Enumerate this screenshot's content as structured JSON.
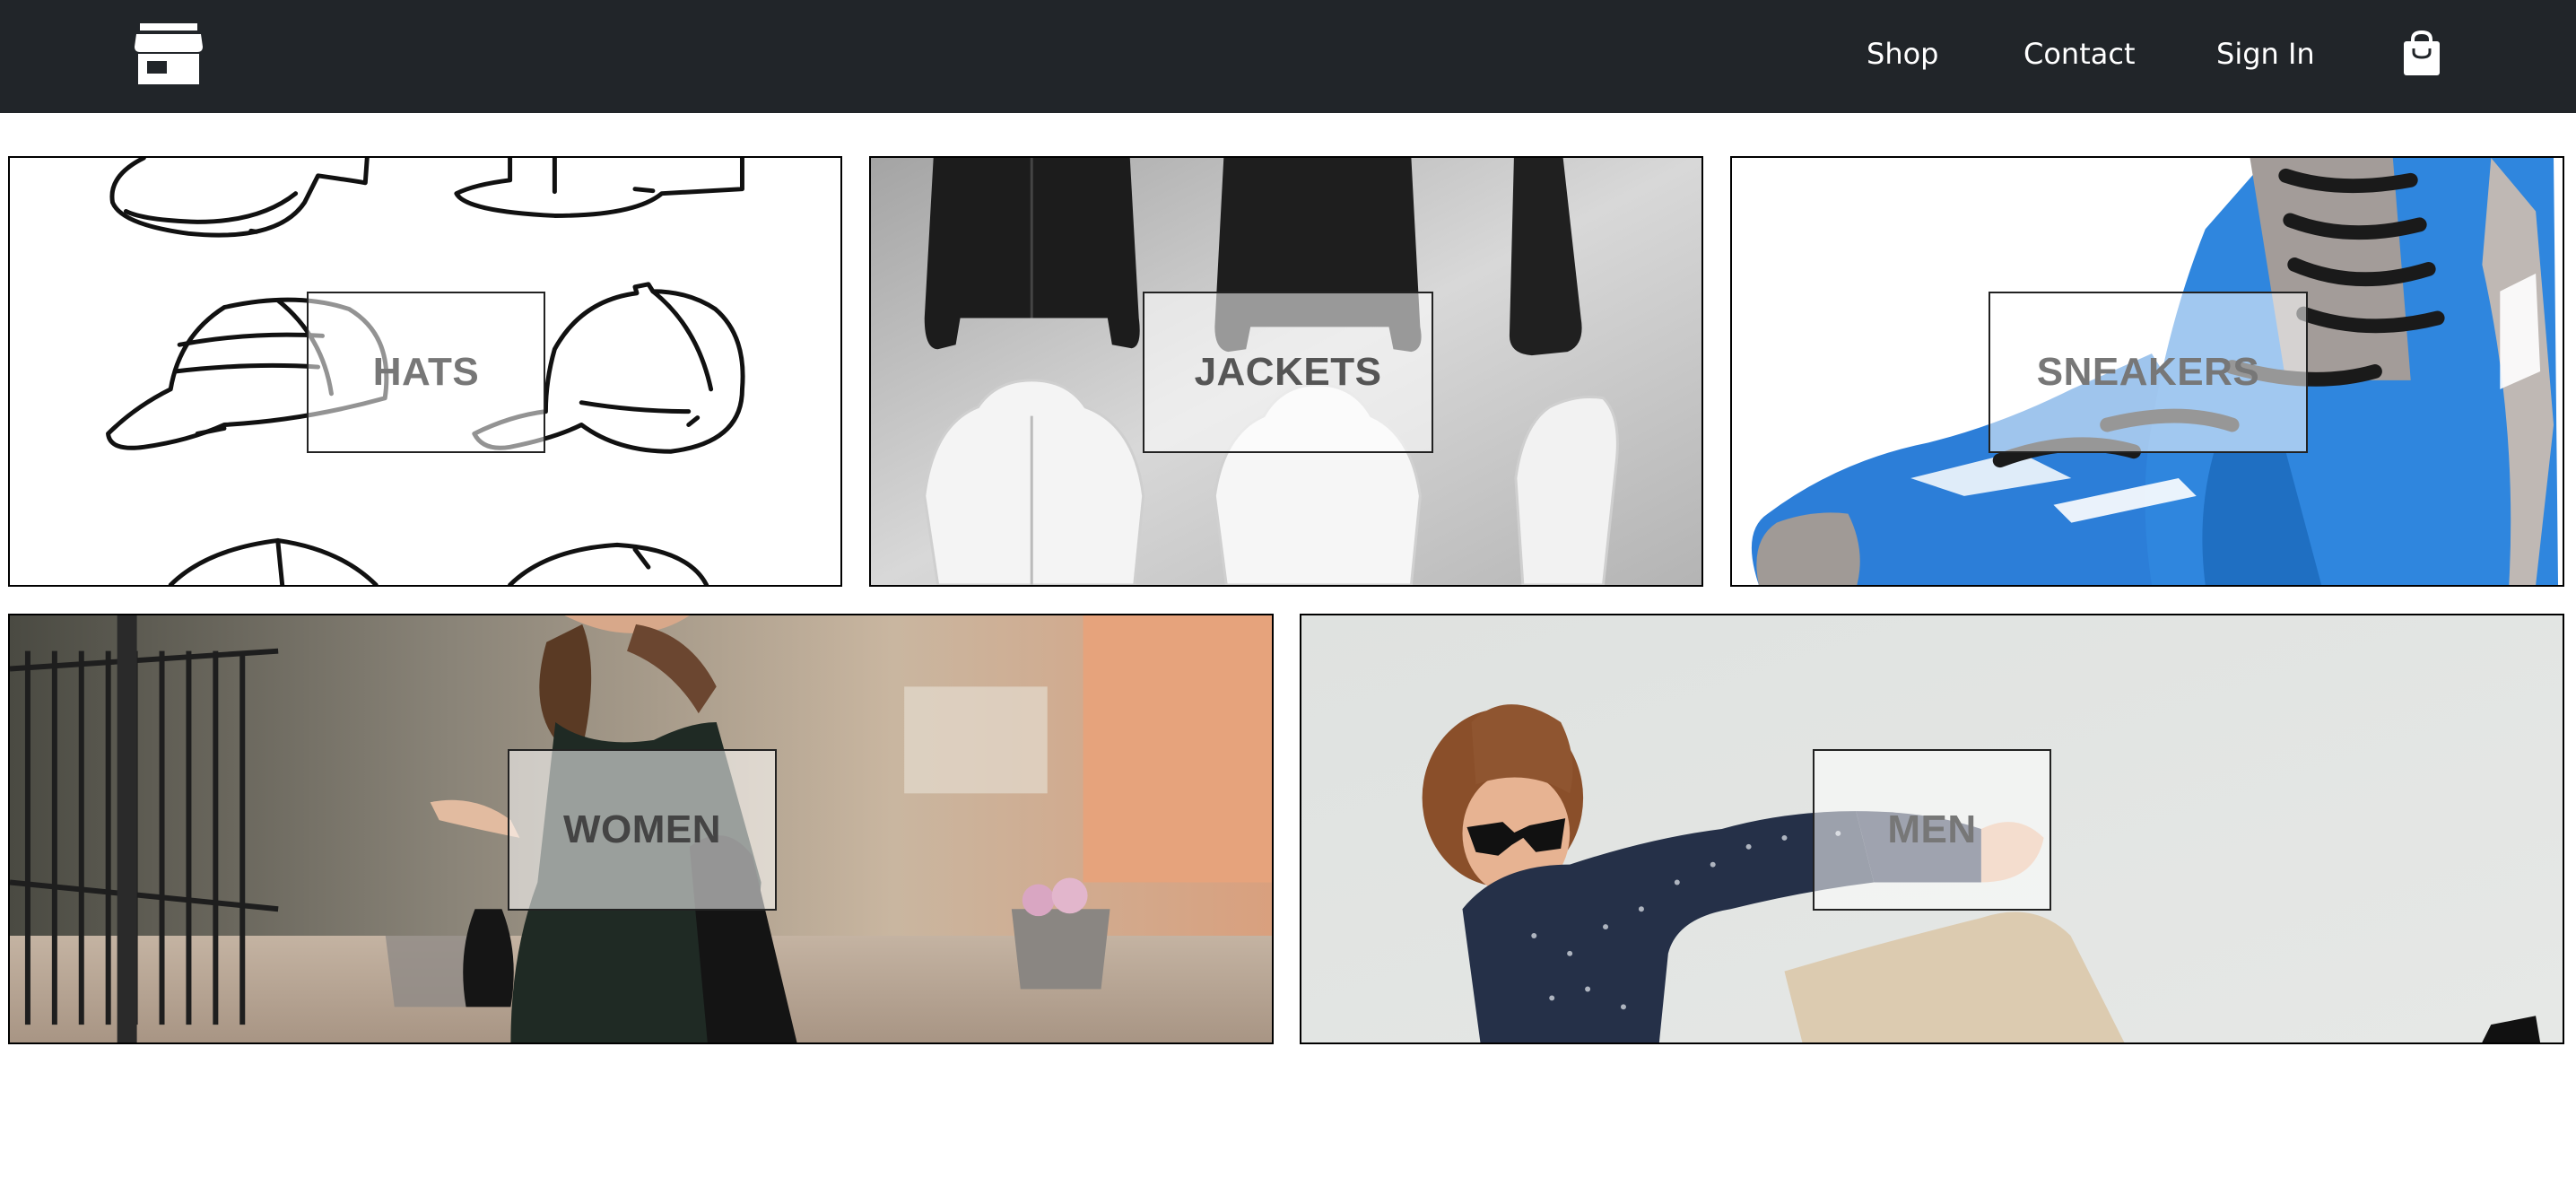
{
  "navbar": {
    "logo_icon": "store-icon",
    "links": {
      "shop": "Shop",
      "contact": "Contact",
      "sign_in": "Sign In"
    },
    "cart_icon": "shopping-bag-icon",
    "background": "#212529",
    "text_color": "#ffffff"
  },
  "categories": {
    "hats": "HATS",
    "jackets": "JACKETS",
    "sneakers": "SNEAKERS",
    "women": "WOMEN",
    "men": "MEN"
  }
}
